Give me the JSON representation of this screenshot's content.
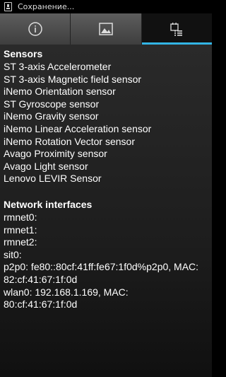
{
  "status_bar": {
    "icon": "sd-card-icon",
    "text": "Сохранение..."
  },
  "tabs": [
    {
      "icon": "info-icon",
      "selected": false
    },
    {
      "icon": "image-icon",
      "selected": false
    },
    {
      "icon": "calendar-list-icon",
      "selected": true
    }
  ],
  "sensors": {
    "title": "Sensors",
    "items": [
      "ST 3-axis Accelerometer",
      "ST 3-axis Magnetic field sensor",
      "iNemo Orientation sensor",
      "ST Gyroscope sensor",
      "iNemo Gravity sensor",
      "iNemo Linear Acceleration sensor",
      "iNemo Rotation Vector sensor",
      "Avago Proximity sensor",
      "Avago Light sensor",
      "Lenovo LEVIR Sensor"
    ]
  },
  "network": {
    "title": "Network interfaces",
    "lines": [
      "rmnet0:",
      "rmnet1:",
      "rmnet2:",
      "sit0:",
      "p2p0: fe80::80cf:41ff:fe67:1f0d%p2p0, MAC:",
      "82:cf:41:67:1f:0d",
      "wlan0: 192.168.1.169, MAC:",
      "80:cf:41:67:1f:0d"
    ]
  },
  "colors": {
    "accent": "#33b5e5",
    "background": "#000000",
    "text": "#ffffff"
  }
}
